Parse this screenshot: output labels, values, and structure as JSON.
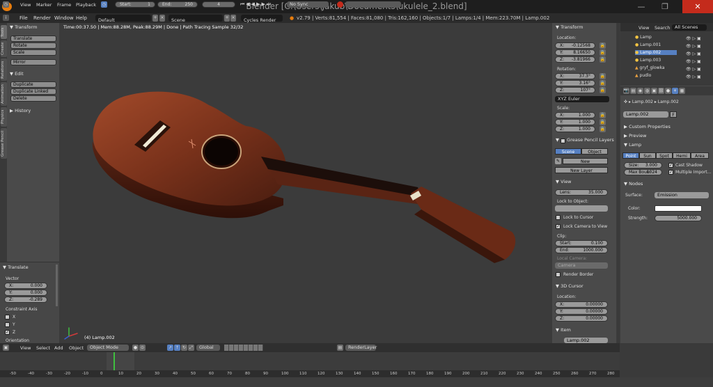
{
  "window": {
    "title": "Blender [C:\\Users\\Jakub\\Documents\\ukulele_2.blend]",
    "min": "—",
    "max": "❐",
    "close": "✕"
  },
  "menubar": {
    "items": [
      "File",
      "Render",
      "Window",
      "Help"
    ],
    "screen": "Default",
    "scene": "Scene",
    "engine": "Cycles Render",
    "stats": "v2.79 | Verts:81,554 | Faces:81,080 | Tris:162,160 | Objects:1/7 | Lamps:1/4 | Mem:223.70M | Lamp.002"
  },
  "toolshelf": {
    "tabs": [
      "Tools",
      "Create",
      "Relations",
      "Animation",
      "Physics",
      "Grease Pencil"
    ],
    "transform_header": "Transform",
    "transform_buttons": [
      "Translate",
      "Rotate",
      "Scale",
      "Mirror"
    ],
    "edit_header": "Edit",
    "edit_buttons": [
      "Duplicate",
      "Duplicate Linked",
      "Delete"
    ],
    "history_header": "History"
  },
  "operator": {
    "header": "Translate",
    "vector_label": "Vector",
    "vector": [
      {
        "k": "X:",
        "v": "0.000"
      },
      {
        "k": "Y:",
        "v": "0.000"
      },
      {
        "k": "Z:",
        "v": "-0.289"
      }
    ],
    "constraint_label": "Constraint Axis",
    "axes": [
      {
        "k": "X",
        "checked": false
      },
      {
        "k": "Y",
        "checked": false
      },
      {
        "k": "Z",
        "checked": true
      }
    ],
    "orientation_label": "Orientation"
  },
  "viewport": {
    "info": "Time:00:37.50 | Mem:88.28M, Peak:88.29M | Done | Path Tracing Sample 32/32",
    "object_label": "(4) Lamp.002"
  },
  "npanel": {
    "transform_header": "Transform",
    "location_label": "Location:",
    "location": [
      {
        "k": "X:",
        "v": "-0.12568"
      },
      {
        "k": "Y:",
        "v": "8.16650"
      },
      {
        "k": "Z:",
        "v": "-3.81966"
      }
    ],
    "rotation_label": "Rotation:",
    "rotation": [
      {
        "k": "X:",
        "v": "37.3°"
      },
      {
        "k": "Y:",
        "v": "3.16°"
      },
      {
        "k": "Z:",
        "v": "107°"
      }
    ],
    "rotation_mode": "XYZ Euler",
    "scale_label": "Scale:",
    "scale": [
      {
        "k": "X:",
        "v": "1.000"
      },
      {
        "k": "Y:",
        "v": "1.000"
      },
      {
        "k": "Z:",
        "v": "1.000"
      }
    ],
    "gp_header": "Grease Pencil Layers",
    "gp_scene": "Scene",
    "gp_object": "Object",
    "gp_new": "New",
    "gp_new_layer": "New Layer",
    "view_header": "View",
    "lens_label": "Lens:",
    "lens_value": "35.000",
    "lock_object_label": "Lock to Object:",
    "lock_cursor": "Lock to Cursor",
    "lock_camera": "Lock Camera to View",
    "clip_label": "Clip:",
    "clip_start_k": "Start:",
    "clip_start_v": "0.100",
    "clip_end_k": "End:",
    "clip_end_v": "1000.000",
    "local_camera_label": "Local Camera:",
    "camera_value": "Camera",
    "render_border": "Render Border",
    "cursor_header": "3D Cursor",
    "cursor_location_label": "Location:",
    "cursor": [
      {
        "k": "X:",
        "v": "0.00000"
      },
      {
        "k": "Y:",
        "v": "0.00000"
      },
      {
        "k": "Z:",
        "v": "0.00000"
      }
    ],
    "item_header": "Item",
    "item_name": "Lamp.002"
  },
  "outliner": {
    "view": "View",
    "search": "Search",
    "filter": "All Scenes",
    "items": [
      "Lamp",
      "Lamp.001",
      "Lamp.002",
      "Lamp.003",
      "gryf_glowka",
      "pudlo"
    ]
  },
  "props": {
    "crumb1": "Lamp.002",
    "crumb2": "Lamp.002",
    "datablock": "Lamp.002",
    "fake": "F",
    "custom_props": "Custom Properties",
    "preview": "Preview",
    "lamp_header": "Lamp",
    "lamp_types": [
      "Point",
      "Sun",
      "Spot",
      "Hemi",
      "Area"
    ],
    "size_k": "Size:",
    "size_v": "3.000",
    "maxbounce_k": "Max Boun:",
    "maxbounce_v": "1024",
    "cast_shadow": "Cast Shadow",
    "multiple_importance": "Multiple Import...",
    "nodes_header": "Nodes",
    "surface_label": "Surface:",
    "surface_value": "Emission",
    "color_label": "Color:",
    "strength_label": "Strength:",
    "strength_value": "5000.000"
  },
  "viewheader": {
    "view": "View",
    "select": "Select",
    "add": "Add",
    "object": "Object",
    "mode": "Object Mode",
    "orientation": "Global",
    "render_layer": "RenderLayer"
  },
  "timeline": {
    "ticks": [
      "-50",
      "-40",
      "-30",
      "-20",
      "-10",
      "0",
      "10",
      "20",
      "30",
      "40",
      "50",
      "60",
      "70",
      "80",
      "90",
      "100",
      "110",
      "120",
      "130",
      "140",
      "150",
      "160",
      "170",
      "180",
      "190",
      "200",
      "210",
      "220",
      "230",
      "240",
      "250",
      "260",
      "270",
      "280"
    ],
    "current_frame": 4
  },
  "tlheader": {
    "view": "View",
    "marker": "Marker",
    "frame": "Frame",
    "playback": "Playback",
    "start_k": "Start:",
    "start_v": "1",
    "end_k": "End:",
    "end_v": "250",
    "current": "4",
    "sync": "No Sync"
  },
  "colors": {
    "accent": "#5680c2",
    "orange": "#e87d0d",
    "close": "#c42b1c",
    "playhead": "#3fbf3f"
  }
}
